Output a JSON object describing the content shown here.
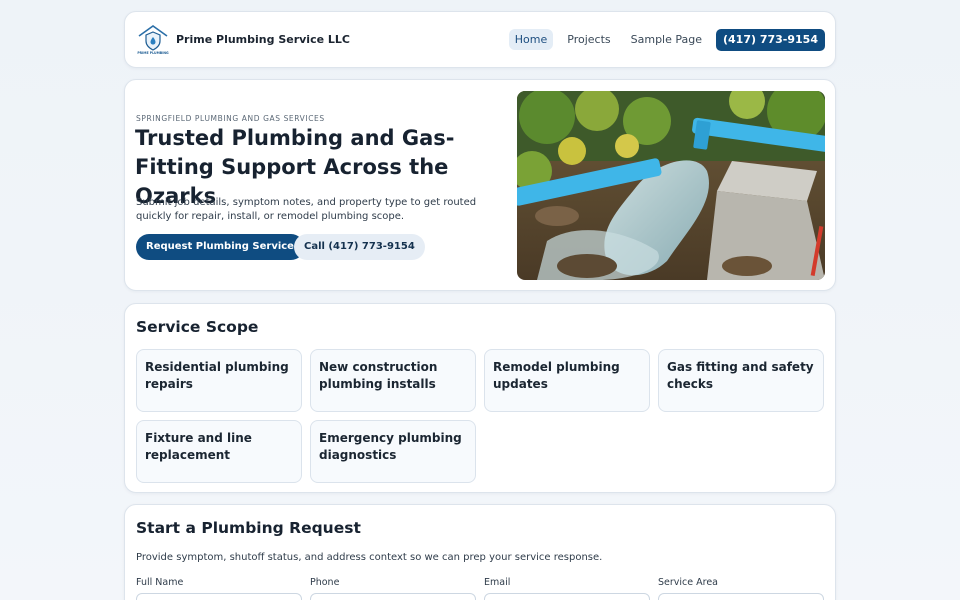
{
  "header": {
    "logo_text": "PRIME PLUMBING",
    "brand": "Prime Plumbing Service LLC",
    "nav": [
      {
        "label": "Home",
        "active": true
      },
      {
        "label": "Projects",
        "active": false
      },
      {
        "label": "Sample Page",
        "active": false
      }
    ],
    "phone_button": "(417) 773-9154"
  },
  "hero": {
    "eyebrow": "SPRINGFIELD PLUMBING AND GAS SERVICES",
    "title": "Trusted Plumbing and Gas-Fitting Support Across the Ozarks",
    "subtitle": "Submit job details, symptom notes, and property type to get routed quickly for repair, install, or remodel plumbing scope.",
    "primary_button": "Request Plumbing Service",
    "secondary_button": "Call (417) 773-9154"
  },
  "services": {
    "title": "Service Scope",
    "items": [
      "Residential plumbing repairs",
      "New construction plumbing installs",
      "Remodel plumbing updates",
      "Gas fitting and safety checks",
      "Fixture and line replacement",
      "Emergency plumbing diagnostics"
    ]
  },
  "request": {
    "title": "Start a Plumbing Request",
    "subtitle": "Provide symptom, shutoff status, and address context so we can prep your service response.",
    "fields": [
      "Full Name",
      "Phone",
      "Email",
      "Service Area"
    ]
  },
  "colors": {
    "brand_blue": "#0f4c81",
    "pipe_blue": "#3fb6e8"
  }
}
